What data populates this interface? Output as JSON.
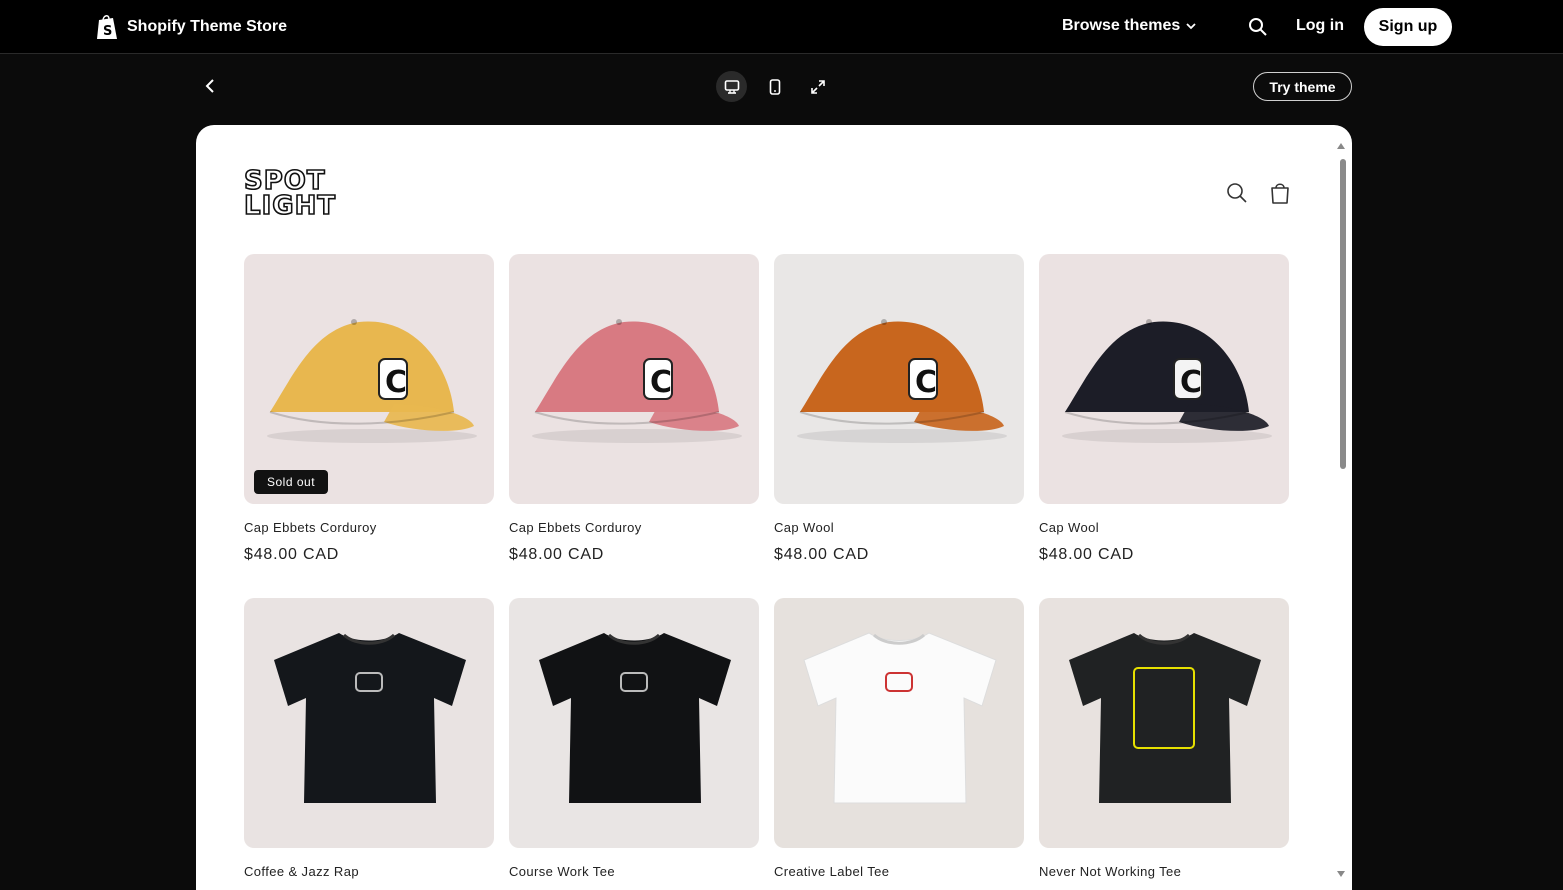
{
  "topbar": {
    "brand": "Shopify Theme Store",
    "browse": "Browse themes",
    "login": "Log in",
    "signup": "Sign up"
  },
  "toolbar": {
    "try_theme": "Try theme"
  },
  "store": {
    "logo_line1": "SPOT",
    "logo_line2": "LIGHT"
  },
  "products": [
    {
      "title": "Cap Ebbets Corduroy",
      "price": "$48.00 CAD",
      "badge": "Sold out",
      "color": "#e8b74f",
      "bg": "#ebe2e2",
      "kind": "cap"
    },
    {
      "title": "Cap Ebbets Corduroy",
      "price": "$48.00 CAD",
      "badge": "",
      "color": "#d87a82",
      "bg": "#ebe2e2",
      "kind": "cap"
    },
    {
      "title": "Cap Wool",
      "price": "$48.00 CAD",
      "badge": "",
      "color": "#c8661e",
      "bg": "#e9e7e6",
      "kind": "cap"
    },
    {
      "title": "Cap Wool",
      "price": "$48.00 CAD",
      "badge": "",
      "color": "#1c1d27",
      "bg": "#ebe2e2",
      "kind": "cap"
    },
    {
      "title": "Coffee & Jazz Rap",
      "price": "",
      "badge": "",
      "color": "#14171b",
      "bg": "#e9e3e2",
      "kind": "tee"
    },
    {
      "title": "Course Work Tee",
      "price": "",
      "badge": "",
      "color": "#111214",
      "bg": "#e9e5e4",
      "kind": "tee"
    },
    {
      "title": "Creative Label Tee",
      "price": "",
      "badge": "",
      "color": "#fbfbfb",
      "bg": "#e6e1dd",
      "kind": "tee"
    },
    {
      "title": "Never Not Working Tee",
      "price": "",
      "badge": "",
      "color": "#202223",
      "bg": "#e8e2df",
      "kind": "tee"
    }
  ]
}
